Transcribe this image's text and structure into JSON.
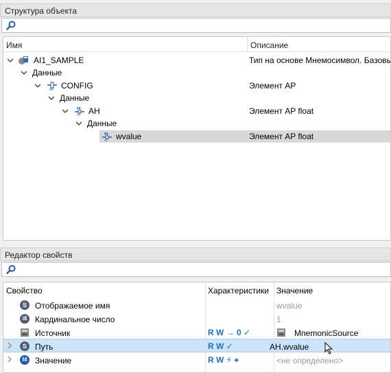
{
  "structure": {
    "title": "Структура объекта",
    "columns": {
      "name": "Имя",
      "description": "Описание"
    },
    "rows": [
      {
        "name": "AI1_SAMPLE",
        "description": "Тип на основе Мнемосимвол. Базовы"
      },
      {
        "name": "Данные",
        "description": ""
      },
      {
        "name": "CONFIG",
        "description": "Элемент AP"
      },
      {
        "name": "Данные",
        "description": ""
      },
      {
        "name": "AH",
        "description": "Элемент AP float"
      },
      {
        "name": "Данные",
        "description": ""
      },
      {
        "name": "wvalue",
        "description": "Элемент AP float"
      }
    ]
  },
  "properties": {
    "title": "Редактор свойств",
    "columns": {
      "property": "Свойство",
      "characteristics": "Характеристики",
      "value": "Значение"
    },
    "rows": [
      {
        "badge": "S",
        "name": "Отображаемое имя",
        "chars": "",
        "value": "wvalue"
      },
      {
        "badge": "i8",
        "name": "Кардинальное число",
        "chars": "",
        "value": "1"
      },
      {
        "badge": "",
        "name": "Источник",
        "chars": "R W → 0 ✓",
        "value": "MnemonicSource"
      },
      {
        "badge": "S",
        "name": "Путь",
        "chars": "R W ✓",
        "value": "AH.wvalue"
      },
      {
        "badge": "f4",
        "name": "Значение",
        "chars": "R W ⚡ ⌖",
        "value": "<не определено>"
      }
    ]
  },
  "colors": {
    "accent": "#1d6fc4",
    "selection_tree": "#d9d9d9",
    "selection_props": "#cce4f7"
  }
}
